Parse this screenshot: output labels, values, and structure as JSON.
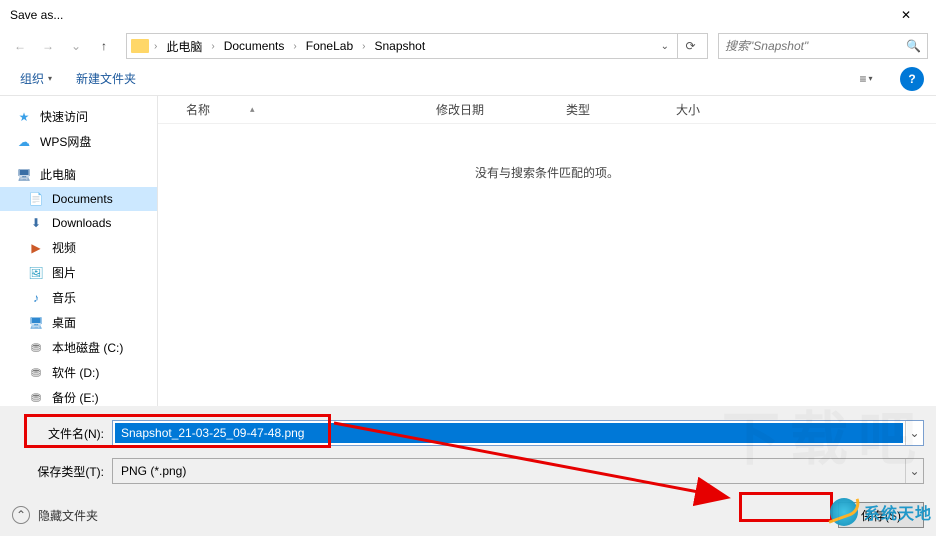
{
  "window": {
    "title": "Save as...",
    "close_icon": "✕"
  },
  "nav": {
    "back_glyph": "←",
    "forward_glyph": "→",
    "history_glyph": "⌄",
    "up_glyph": "↑",
    "refresh_glyph": "⟳",
    "dropdown_glyph": "⌄",
    "search_glyph": "🔍"
  },
  "breadcrumb": {
    "items": [
      "此电脑",
      "Documents",
      "FoneLab",
      "Snapshot"
    ]
  },
  "search": {
    "placeholder": "搜索\"Snapshot\""
  },
  "toolbar": {
    "organize": "组织",
    "new_folder": "新建文件夹",
    "view_glyph": "≡",
    "help_glyph": "?"
  },
  "tree": {
    "items": [
      {
        "label": "快速访问",
        "icon": "★",
        "color": "#3aa0e8"
      },
      {
        "label": "WPS网盘",
        "icon": "☁",
        "color": "#3aa0e8"
      },
      {
        "label": "此电脑",
        "icon": "🖥",
        "color": "#3a6ea5",
        "spacer_before": true
      },
      {
        "label": "Documents",
        "icon": "📄",
        "selected": true,
        "sub": true,
        "color": "#3a6ea5"
      },
      {
        "label": "Downloads",
        "icon": "⬇",
        "sub": true,
        "color": "#3a6ea5"
      },
      {
        "label": "视频",
        "icon": "▶",
        "sub": true,
        "color": "#cc5a28"
      },
      {
        "label": "图片",
        "icon": "🖼",
        "sub": true,
        "color": "#35a2c5"
      },
      {
        "label": "音乐",
        "icon": "♪",
        "sub": true,
        "color": "#2e88d0"
      },
      {
        "label": "桌面",
        "icon": "🖥",
        "sub": true,
        "color": "#2e88d0"
      },
      {
        "label": "本地磁盘 (C:)",
        "icon": "⛃",
        "sub": true,
        "color": "#7a7a7a"
      },
      {
        "label": "软件 (D:)",
        "icon": "⛃",
        "sub": true,
        "color": "#7a7a7a"
      },
      {
        "label": "备份 (E:)",
        "icon": "⛃",
        "sub": true,
        "color": "#7a7a7a"
      }
    ]
  },
  "list": {
    "columns": {
      "name": "名称",
      "date": "修改日期",
      "type": "类型",
      "size": "大小",
      "sort_glyph": "▴"
    },
    "empty_message": "没有与搜索条件匹配的项。"
  },
  "footer": {
    "filename_label": "文件名(N):",
    "filename_value": "Snapshot_21-03-25_09-47-48.png",
    "filetype_label": "保存类型(T):",
    "filetype_value": "PNG (*.png)",
    "hide_folders": "隐藏文件夹",
    "save_button": "保存(S)",
    "collapse_glyph": "⌃"
  },
  "watermark": {
    "text": "系统天地",
    "bg_text": "下载吧"
  }
}
